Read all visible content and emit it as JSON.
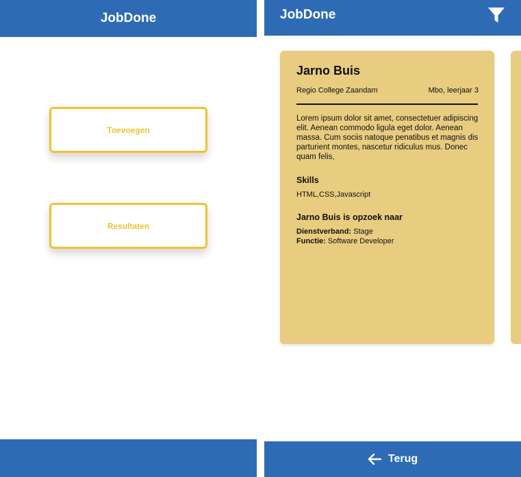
{
  "app": {
    "title": "JobDone"
  },
  "home": {
    "buttons": {
      "add_label": "Toevoegen",
      "results_label": "Resultaten"
    }
  },
  "results": {
    "filter_icon": "filter-icon",
    "card": {
      "name": "Jarno Buis",
      "school": "Regio College Zaandam",
      "level": "Mbo, leerjaar 3",
      "description": "Lorem ipsum dolor sit amet, consectetuer adipiscing elit. Aenean commodo ligula eget dolor. Aenean massa. Cum sociis natoque penatibus et magnis dis parturient montes, nascetur ridiculus mus. Donec quam felis,",
      "skills_heading": "Skills",
      "skills": "HTML,CSS,Javascript",
      "seeking_heading": "Jarno Buis is opzoek naar",
      "employment_label": "Dienstverband:",
      "employment_value": "Stage",
      "function_label": "Functie:",
      "function_value": "Software Developer"
    },
    "footer": {
      "back_label": "Terug",
      "back_icon": "arrow-left-icon"
    }
  },
  "colors": {
    "primary": "#2f6bb5",
    "accent": "#f2c12e",
    "card": "#e8cc80"
  }
}
